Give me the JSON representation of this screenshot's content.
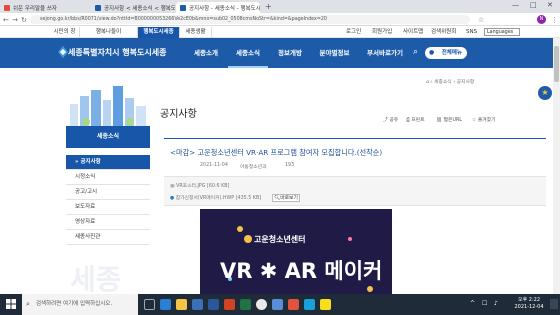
{
  "browser": {
    "tabs": [
      {
        "label": "쉬운 우리말을 쓰자",
        "fav_color": "#e24a3b"
      },
      {
        "label": "공지사항 < 세종소식 < 행복도시 세...",
        "fav_color": "#1d5ba8"
      },
      {
        "label": "공지사항 - 세종소식 - 행복도시 세...",
        "fav_color": "#1d5ba8"
      }
    ],
    "new_tab": "+",
    "controls": {
      "minimize": "—",
      "maximize": "□",
      "close": "✕"
    },
    "url": "sejong.go.kr/bbs/R0071/view.do?nttId=B000000053266Ve2cE0b&mno=sub02_0508cmsNoStr=&kind=&pageIndex=20",
    "profile_initial": "N"
  },
  "utilbar": {
    "site_tabs": [
      "시민의 창",
      "행복나들이",
      "행복도시세종",
      "세종생활"
    ],
    "links": [
      "로그인",
      "회원가입",
      "사이트맵",
      "검색위원회",
      "SNS"
    ],
    "lang": "Languages"
  },
  "gnb": {
    "logo": "세종특별자치시 행복도시세종",
    "items": [
      "세종소개",
      "세종소식",
      "정보개방",
      "분야별정보",
      "부서바로가기"
    ],
    "all_menu": "전체메뉴"
  },
  "sidebar": {
    "heading": "세종소식",
    "items": [
      "공지사항",
      "시정소식",
      "공고/고시",
      "보도자료",
      "영상자료",
      "세종사진관"
    ]
  },
  "content": {
    "page_title": "공지사항",
    "tools": [
      "공유",
      "프린트",
      "짧은URL",
      "즐겨찾기"
    ],
    "post_title": "<마감> 고운청소년센터 VR·AR 프로그램 참여자 모집합니다.(선착순)",
    "date": "2021-11-04",
    "dept": "아동청소년과",
    "views": "193",
    "attachments": [
      "VR포스터.JPG [60.6 KB]",
      "참가신청서(VR메이커).HWP [435.5 KB]"
    ],
    "preview": "바로보기",
    "poster_org": "고운청소년센터",
    "poster_main": "VR ✱ AR 메이커"
  },
  "taskbar": {
    "search_placeholder": "검색하려면 여기에 입력하십시오.",
    "time": "오후 2:22",
    "date": "2021-12-04"
  },
  "colors": {
    "brand": "#1d5ba8",
    "active": "#1756a9"
  }
}
